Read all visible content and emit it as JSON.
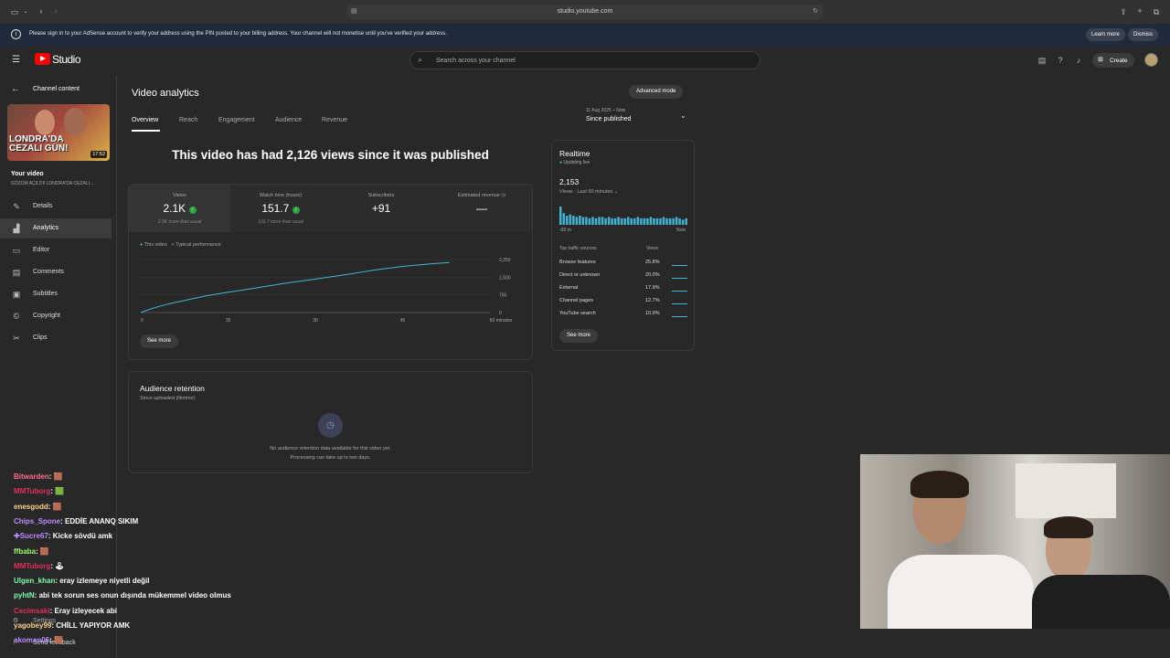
{
  "browser": {
    "url": "studio.youtube.com"
  },
  "banner": {
    "message": "Please sign in to your AdSense account to verify your address using the PIN posted to your billing address. Your channel will not monetise until you've verified your address.",
    "learn_more": "Learn more",
    "dismiss": "Dismiss"
  },
  "header": {
    "logo": "Studio",
    "search_placeholder": "Search across your channel",
    "create": "Create"
  },
  "sidebar": {
    "back_label": "Channel content",
    "thumb_duration": "17:52",
    "thumb_text": "LONDRA'DA CEZALI GÜN!",
    "your_video": "Your video",
    "video_title": "GÖZÜM AÇILDI! LONDRA'DA CEZALI...",
    "items": [
      {
        "label": "Details",
        "icon": "pencil-icon"
      },
      {
        "label": "Analytics",
        "icon": "analytics-icon"
      },
      {
        "label": "Editor",
        "icon": "editor-icon"
      },
      {
        "label": "Comments",
        "icon": "comments-icon"
      },
      {
        "label": "Subtitles",
        "icon": "subtitles-icon"
      },
      {
        "label": "Copyright",
        "icon": "copyright-icon"
      },
      {
        "label": "Clips",
        "icon": "scissors-icon"
      }
    ],
    "settings": "Settings",
    "feedback": "Send feedback"
  },
  "main": {
    "title": "Video analytics",
    "advanced_mode": "Advanced mode",
    "tabs": [
      "Overview",
      "Reach",
      "Engagement",
      "Audience",
      "Revenue"
    ],
    "date_range_small": "11 Aug 2025 – Now",
    "date_range": "Since published",
    "headline": "This video has had 2,126 views since it was published",
    "metrics": [
      {
        "label": "Views",
        "value": "2.1K",
        "sub": "2.0K more than usual"
      },
      {
        "label": "Watch time (hours)",
        "value": "151.7",
        "sub": "131.7 more than usual"
      },
      {
        "label": "Subscribers",
        "value": "+91",
        "sub": ""
      },
      {
        "label": "Estimated revenue",
        "value": "—",
        "sub": ""
      }
    ],
    "legend": [
      "This video",
      "Typical performance"
    ],
    "see_more": "See more",
    "retention_title": "Audience retention",
    "retention_sub": "Since uploaded (lifetime)",
    "retention_empty1": "No audience retention data available for this video yet.",
    "retention_empty2": "Processing can take up to two days."
  },
  "chart_data": {
    "type": "line",
    "x": [
      0,
      2,
      5,
      8,
      11,
      15,
      20,
      25,
      30,
      35,
      40,
      45,
      50,
      53
    ],
    "series": [
      {
        "name": "This video",
        "values": [
          0,
          180,
          380,
          540,
          700,
          860,
          1050,
          1250,
          1420,
          1600,
          1800,
          1960,
          2070,
          2126
        ]
      }
    ],
    "x_ticks": [
      "0",
      "15",
      "30",
      "45",
      "60 minutes"
    ],
    "y_ticks": [
      "0",
      "750",
      "1,500",
      "2,250"
    ],
    "xlim": [
      0,
      60
    ],
    "ylim": [
      0,
      2250
    ]
  },
  "realtime": {
    "title": "Realtime",
    "live": "Updating live",
    "count": "2,153",
    "period": "Views · Last 60 minutes",
    "axis_start": "-60 m",
    "axis_end": "Now",
    "sources_header": "Top traffic sources",
    "views_header": "Views",
    "bars": [
      14,
      9,
      7,
      8,
      7,
      6,
      7,
      6,
      6,
      5,
      6,
      5,
      6,
      6,
      5,
      6,
      5,
      5,
      6,
      5,
      5,
      6,
      5,
      5,
      6,
      5,
      5,
      5,
      6,
      5,
      5,
      5,
      6,
      5,
      5,
      5,
      6,
      5,
      4,
      5
    ],
    "sources": [
      {
        "name": "Browse features",
        "pct": "25.8%"
      },
      {
        "name": "Direct or unknown",
        "pct": "20.0%"
      },
      {
        "name": "External",
        "pct": "17.9%"
      },
      {
        "name": "Channel pages",
        "pct": "12.7%"
      },
      {
        "name": "YouTube search",
        "pct": "10.9%"
      }
    ],
    "see_more": "See more"
  },
  "chat": [
    {
      "user": "Bitwarden",
      "msg": "🟫",
      "color": "#ff6b8a"
    },
    {
      "user": "MMTuborg",
      "msg": "🟩",
      "color": "#e0305a"
    },
    {
      "user": "enesgodd",
      "msg": "🟫",
      "color": "#ffd08a"
    },
    {
      "user": "Chips_Spone",
      "msg": "EDDİE ANANQ SIKIM",
      "color": "#b98cff"
    },
    {
      "user": "✚Sucre67",
      "msg": "Kicke sövdü amk",
      "color": "#b98cff"
    },
    {
      "user": "ffbaba",
      "msg": "🟫",
      "color": "#9cff6b"
    },
    {
      "user": "MMTuborg",
      "msg": "🕹",
      "color": "#e0305a"
    },
    {
      "user": "Ulgen_khan",
      "msg": "eray izlemeye niyetli değil",
      "color": "#7dffb0"
    },
    {
      "user": "pyhtN",
      "msg": "abi tek sorun ses onun dışında mükemmel video olmus",
      "color": "#7dffb0"
    },
    {
      "user": "Cecimsaki",
      "msg": "Eray izleyecek abi",
      "color": "#e0305a"
    },
    {
      "user": "yagobey99",
      "msg": "CHİLL YAPIYOR AMK",
      "color": "#ffd08a"
    },
    {
      "user": "akoman06",
      "msg": "🟫",
      "color": "#b98cff"
    }
  ]
}
